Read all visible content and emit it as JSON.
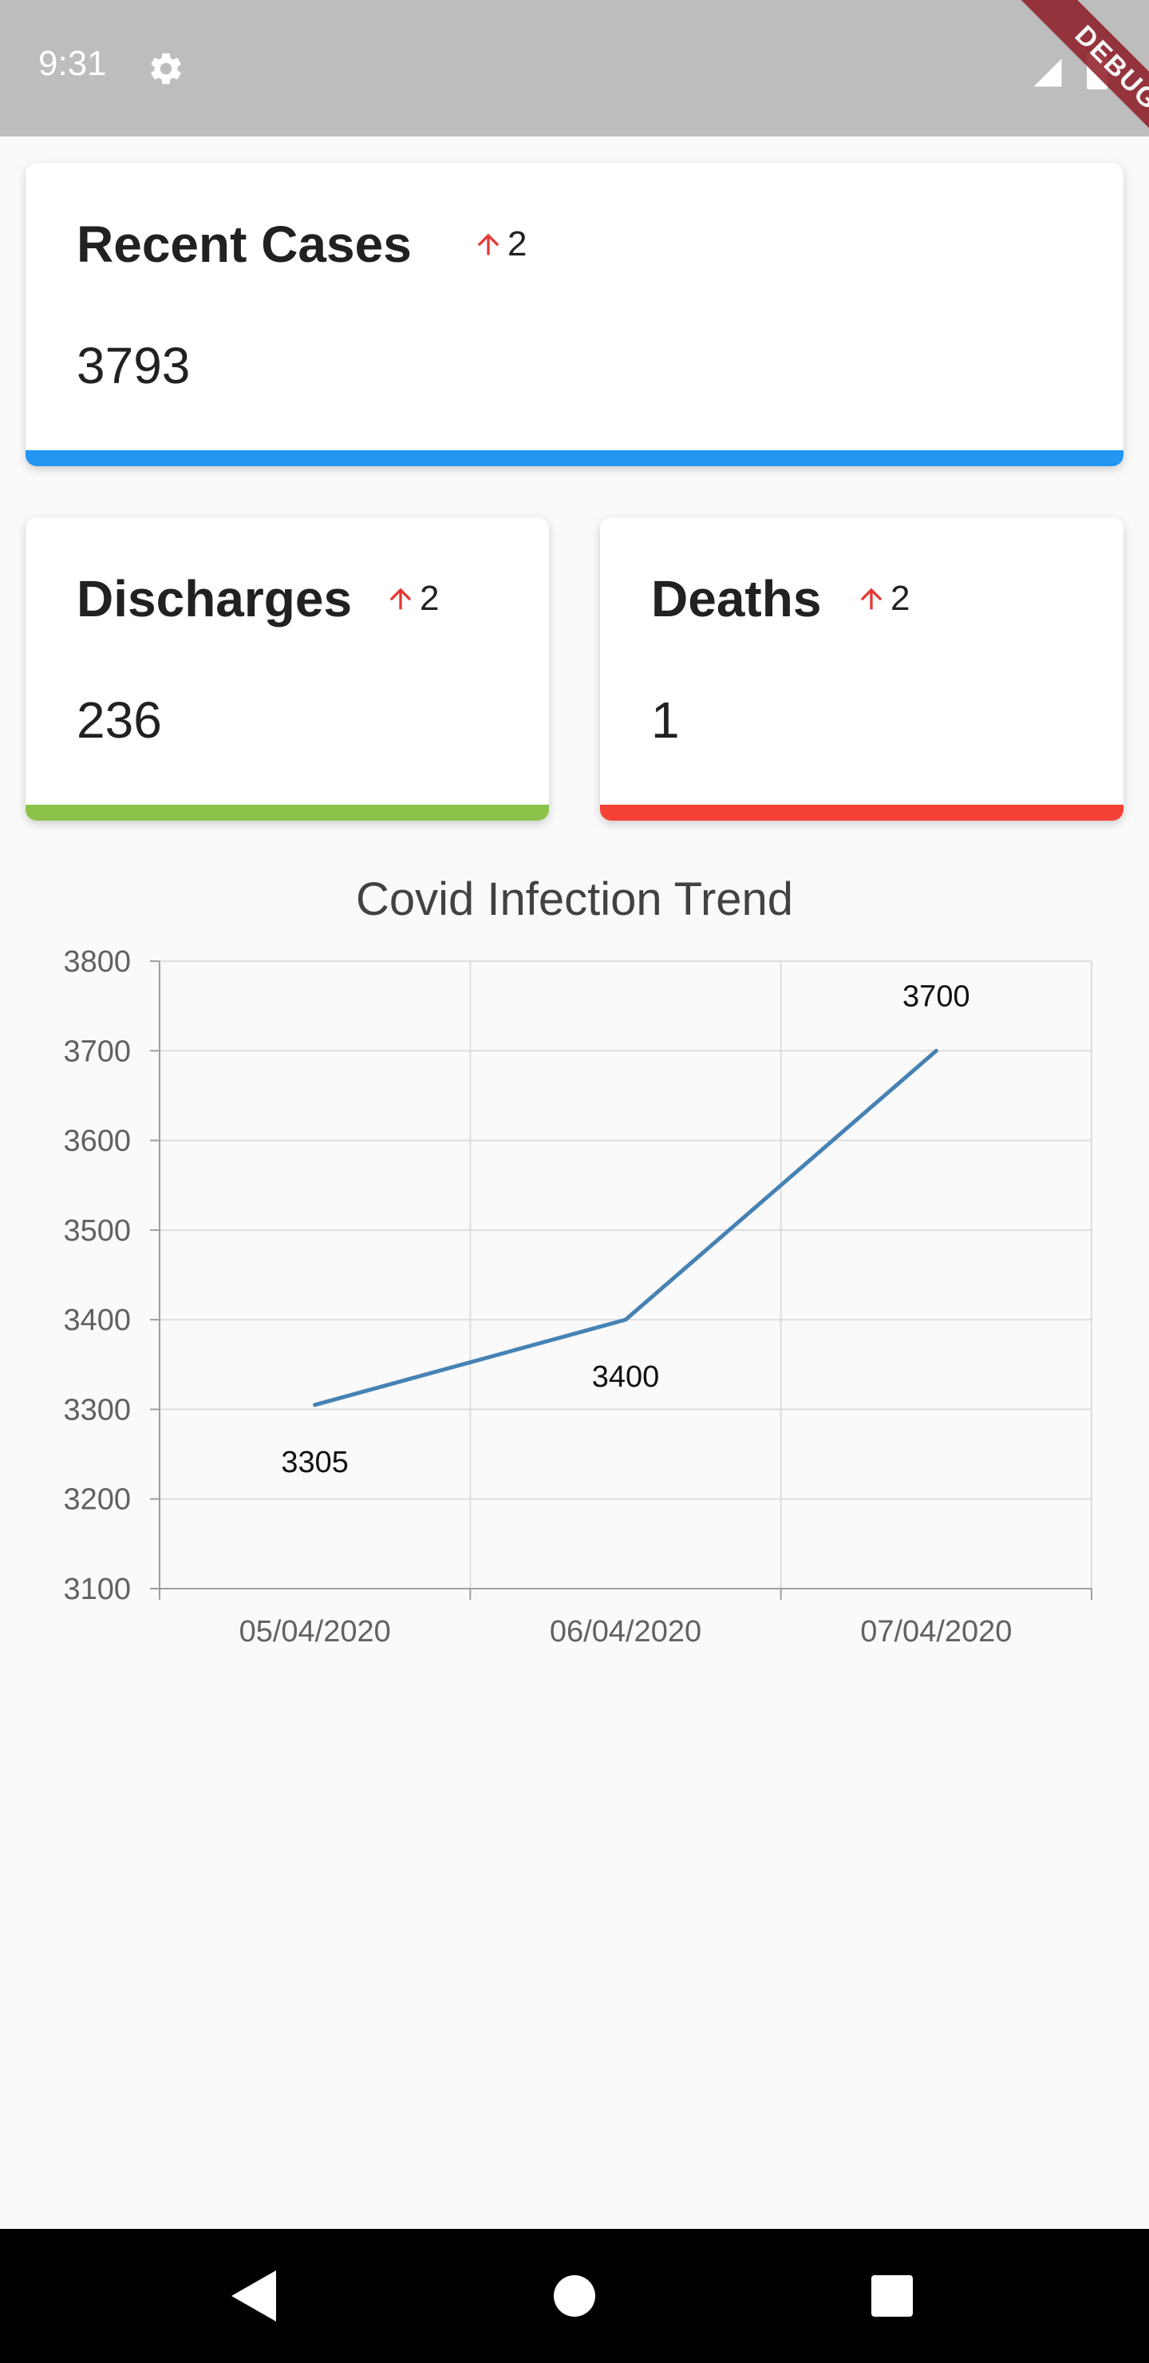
{
  "status_bar": {
    "time": "9:31",
    "icons": [
      "gear-icon",
      "signal-icon",
      "battery-icon"
    ]
  },
  "debug_banner": "DEBUG",
  "cards": {
    "recent": {
      "title": "Recent Cases",
      "delta": "2",
      "value": "3793",
      "color": "#2196f3"
    },
    "discharges": {
      "title": "Discharges",
      "delta": "2",
      "value": "236",
      "color": "#8bc34a"
    },
    "deaths": {
      "title": "Deaths",
      "delta": "2",
      "value": "1",
      "color": "#f44336"
    }
  },
  "arrow_color": "#e53935",
  "chart_data": {
    "type": "line",
    "title": "Covid Infection Trend",
    "categories": [
      "05/04/2020",
      "06/04/2020",
      "07/04/2020"
    ],
    "series": [
      {
        "values": [
          3305,
          3400,
          3700
        ],
        "color": "#4682b4"
      }
    ],
    "ylim": [
      3100,
      3800
    ],
    "yticks": [
      3100,
      3200,
      3300,
      3400,
      3500,
      3600,
      3700,
      3800
    ],
    "grid": true,
    "data_labels": true
  },
  "nav_bar": {
    "icons": [
      "back-icon",
      "home-icon",
      "recents-icon"
    ]
  }
}
